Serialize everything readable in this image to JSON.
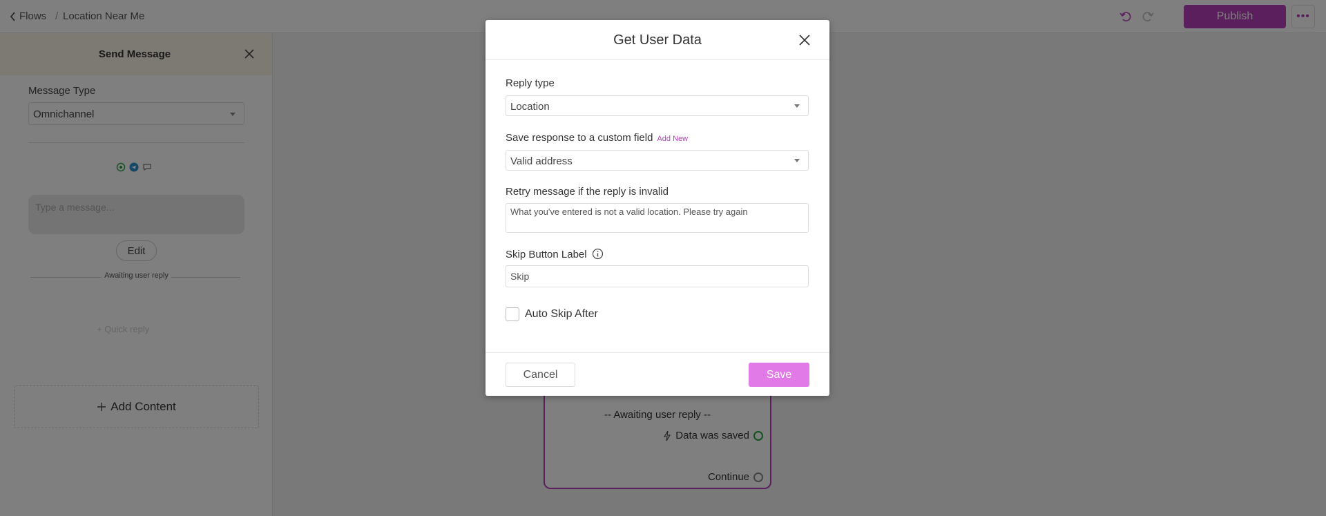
{
  "topbar": {
    "back_label": "Flows",
    "separator": "/",
    "current": "Location Near Me",
    "publish_label": "Publish",
    "more_label": "•••"
  },
  "panel": {
    "title": "Send Message",
    "message_type_label": "Message Type",
    "message_type_value": "Omnichannel",
    "message_placeholder": "Type a message...",
    "edit_label": "Edit",
    "awaiting_label": "Awaiting user reply",
    "quick_reply_label": "+ Quick reply",
    "add_content_label": "Add Content"
  },
  "node": {
    "awaiting_label": "-- Awaiting user reply --",
    "data_saved_label": "Data was saved",
    "continue_label": "Continue"
  },
  "modal": {
    "title": "Get User Data",
    "reply_type_label": "Reply type",
    "reply_type_value": "Location",
    "save_response_label": "Save response to a custom field",
    "add_new_label": "Add New",
    "save_response_value": "Valid address",
    "retry_label": "Retry message if the reply is invalid",
    "retry_value": "What you've entered is not a valid location. Please try again",
    "skip_label": "Skip Button Label",
    "skip_value": "Skip",
    "auto_skip_label": "Auto Skip After",
    "cancel_label": "Cancel",
    "save_label": "Save"
  },
  "colors": {
    "accent": "#b53fb9",
    "save_button": "#e17ae6",
    "panel_header": "#fbf3e6",
    "success": "#27a644"
  }
}
